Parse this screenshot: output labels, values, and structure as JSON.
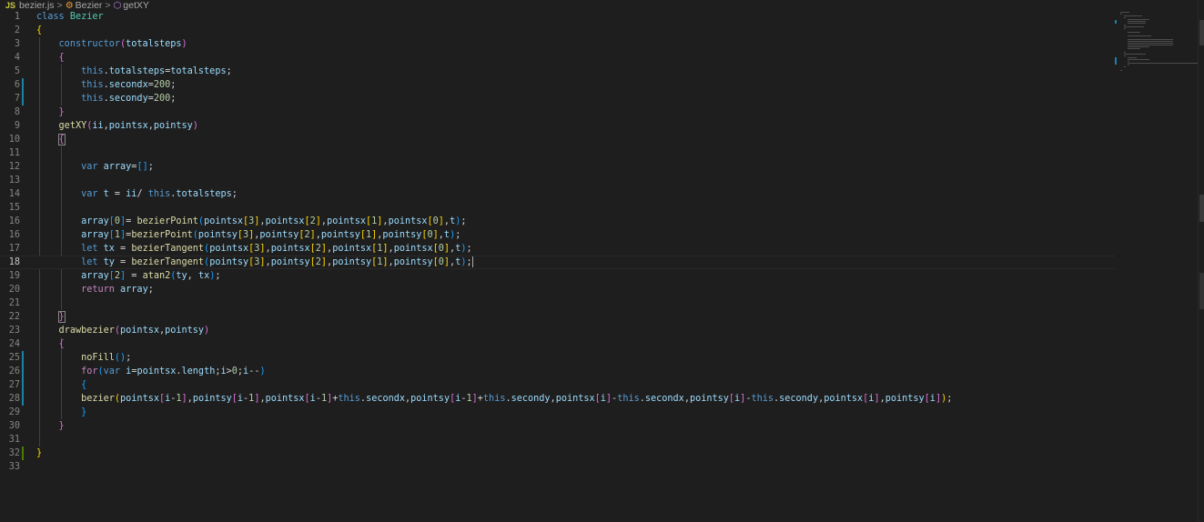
{
  "breadcrumb": {
    "file_icon": "JS",
    "file": "bezier.js",
    "separator": ">",
    "class_name": "Bezier",
    "method": "getXY"
  },
  "editor": {
    "current_line": 18,
    "line_numbers": [
      "1",
      "2",
      "3",
      "4",
      "5",
      "6",
      "7",
      "8",
      "9",
      "10",
      "11",
      "12",
      "13",
      "14",
      "15",
      "16",
      "17",
      "18",
      "19",
      "20",
      "21",
      "22",
      "23",
      "24",
      "25",
      "26",
      "27",
      "28",
      "29",
      "30",
      "31",
      "32",
      "33"
    ]
  }
}
